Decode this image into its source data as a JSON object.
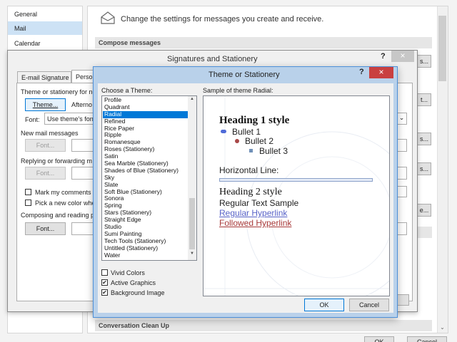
{
  "sidebar": {
    "items": [
      "General",
      "Mail",
      "Calendar"
    ]
  },
  "mail_options": {
    "header_text": "Change the settings for messages you create and receive.",
    "compose_section": "Compose messages",
    "conversation_section": "Conversation Clean Up",
    "right_buttons": [
      "s...",
      "t...",
      "s...",
      "s...",
      "e..."
    ],
    "ok_label": "OK",
    "cancel_label": "Cancel"
  },
  "signatures": {
    "title": "Signatures and Stationery",
    "help": "?",
    "close": "×",
    "tabs": [
      "E-mail Signature",
      "Perso"
    ],
    "theme_label": "Theme or stationery for ne",
    "theme_button": "Theme...",
    "theme_value": "Afterno",
    "font_label": "Font:",
    "font_value": "Use theme's font",
    "new_mail_label": "New mail messages",
    "font_button": "Font...",
    "reply_label": "Replying or forwarding m",
    "mark_comments_label": "Mark my comments w",
    "pick_color_label": "Pick a new color whe",
    "compose_read_label": "Composing and reading p",
    "chevron": "⌄"
  },
  "theme_dialog": {
    "title": "Theme or Stationery",
    "help": "?",
    "close": "×",
    "choose_label": "Choose a Theme:",
    "sample_label": "Sample of theme Radial:",
    "themes": [
      "Profile",
      "Quadrant",
      "Radial",
      "Refined",
      "Rice Paper",
      "Ripple",
      "Romanesque",
      "Roses (Stationery)",
      "Satin",
      "Sea Marble (Stationery)",
      "Shades of Blue (Stationery)",
      "Sky",
      "Slate",
      "Soft Blue (Stationery)",
      "Sonora",
      "Spring",
      "Stars (Stationery)",
      "Straight Edge",
      "Studio",
      "Sumi Painting",
      "Tech Tools (Stationery)",
      "Untitled (Stationery)",
      "Water"
    ],
    "selected_theme": "Radial",
    "scroll_up": "▲",
    "scroll_down": "▼",
    "options": [
      {
        "label": "Vivid Colors",
        "checked": false
      },
      {
        "label": "Active Graphics",
        "checked": true
      },
      {
        "label": "Background Image",
        "checked": true
      }
    ],
    "check_mark": "✔",
    "sample": {
      "heading1": "Heading 1 style",
      "bullet1": "Bullet 1",
      "bullet2": "Bullet 2",
      "bullet3": "Bullet 3",
      "hline_label": "Horizontal Line:",
      "heading2": "Heading 2 style",
      "regular": "Regular Text Sample",
      "link": "Regular Hyperlink",
      "followed": "Followed Hyperlink"
    },
    "ok_label": "OK",
    "cancel_label": "Cancel"
  }
}
